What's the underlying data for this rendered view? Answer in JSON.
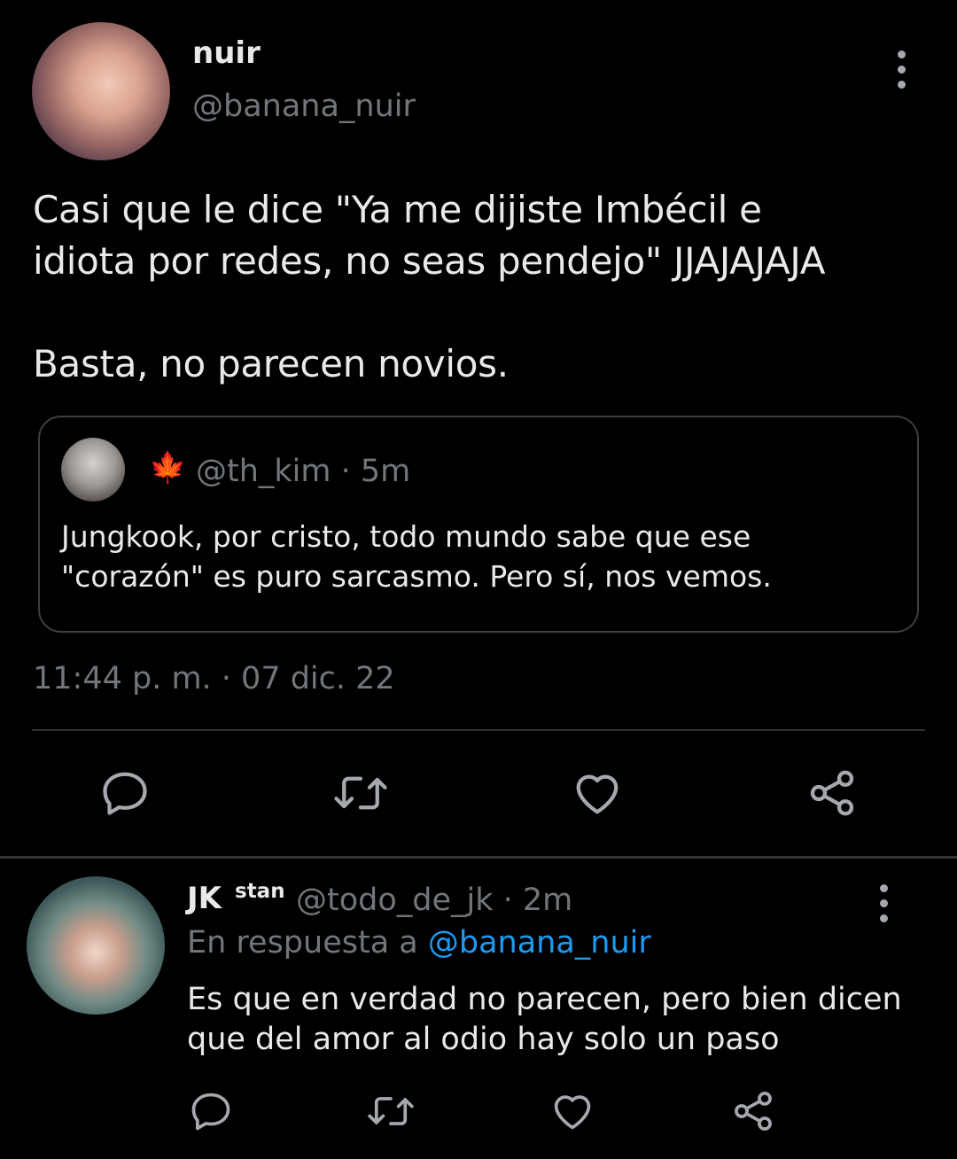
{
  "main_tweet": {
    "display_name": "nuir",
    "handle": "@banana_nuir",
    "text": "Casi que le dice \"Ya me dijiste Imbécil e\nidiota por redes, no seas pendejo\" JJAJAJAJA\n\nBasta, no parecen novios.",
    "quoted": {
      "emoji": "🍁",
      "handle_time": "@th_kim · 5m",
      "text": "Jungkook, por cristo, todo mundo sabe que ese\n\"corazón\" es puro sarcasmo. Pero sí, nos vemos."
    },
    "timestamp": "11:44 p. m. · 07 dic. 22"
  },
  "reply_tweet": {
    "display_name": "JK",
    "name_superscript": "stan",
    "handle_time": "@todo_de_jk · 2m",
    "context_prefix": "En respuesta a ",
    "context_mention": "@banana_nuir",
    "text": "Es que en verdad no parecen, pero bien dicen\nque del amor al odio hay solo un paso"
  },
  "icons": {
    "reply": "reply-icon",
    "retweet": "retweet-icon",
    "like": "heart-icon",
    "share": "share-icon",
    "more": "more-vertical-icon"
  },
  "colors": {
    "background": "#000000",
    "text": "#e7e9ea",
    "muted": "#71767b",
    "link": "#1d9bf0",
    "border": "#2f3336"
  }
}
